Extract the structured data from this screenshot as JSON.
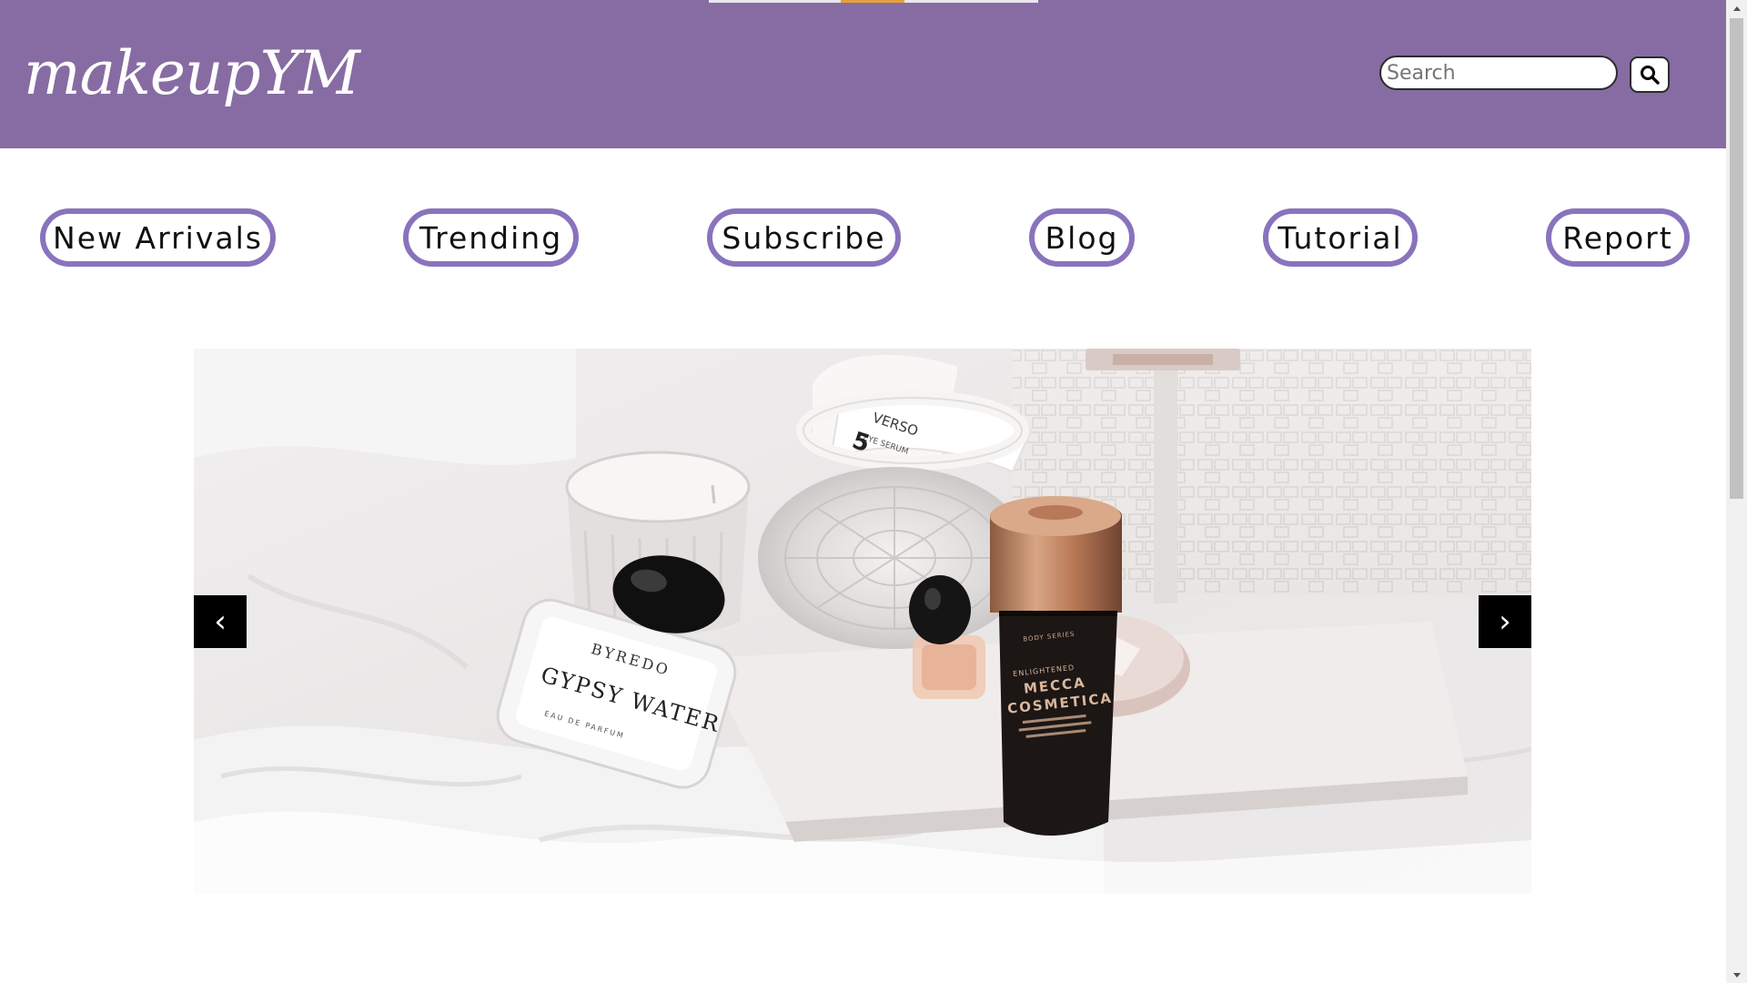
{
  "header": {
    "logo_text": "makeupYM",
    "bg_color": "#876ca3",
    "search": {
      "placeholder": "Search",
      "value": ""
    },
    "search_button_icon": "search-icon"
  },
  "nav": {
    "items": [
      {
        "label": "New Arrivals"
      },
      {
        "label": "Trending"
      },
      {
        "label": "Subscribe"
      },
      {
        "label": "Blog"
      },
      {
        "label": "Tutorial"
      },
      {
        "label": "Report"
      }
    ],
    "border_color": "#8a73bd"
  },
  "carousel": {
    "prev_label": "‹",
    "next_label": "›",
    "image_product_texts": {
      "perfume_brand": "BYREDO",
      "perfume_name": "GYPSY WATER",
      "perfume_sub": "EAU DE PARFUM",
      "oil_top": "BODY SERIES",
      "oil_line1": "ENLIGHTENED",
      "oil_line2": "MECCA",
      "oil_line3": "COSMETICA",
      "tube_text": "VERSO",
      "tube_sub": "EYE SERUM"
    }
  },
  "scrollbar": {
    "up_icon": "scroll-up-arrow-icon",
    "down_icon": "scroll-down-arrow-icon"
  }
}
